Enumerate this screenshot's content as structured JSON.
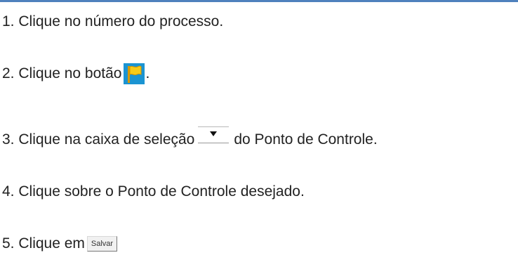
{
  "steps": [
    {
      "number": "1.",
      "text_before": "Clique no número do processo."
    },
    {
      "number": "2.",
      "text_before": "Clique no botão",
      "icon": "flag-icon",
      "text_after": "."
    },
    {
      "number": "3.",
      "text_before": "Clique na caixa de seleção",
      "icon": "dropdown-arrow-icon",
      "text_after": "do Ponto de Controle."
    },
    {
      "number": "4.",
      "text_before": "Clique sobre o Ponto de Controle desejado."
    },
    {
      "number": "5.",
      "text_before": "Clique em",
      "button_label": "Salvar"
    }
  ],
  "colors": {
    "rule": "#4f81bd",
    "flag_button_bg": "#1b94d2",
    "flag": "#f5c400"
  }
}
